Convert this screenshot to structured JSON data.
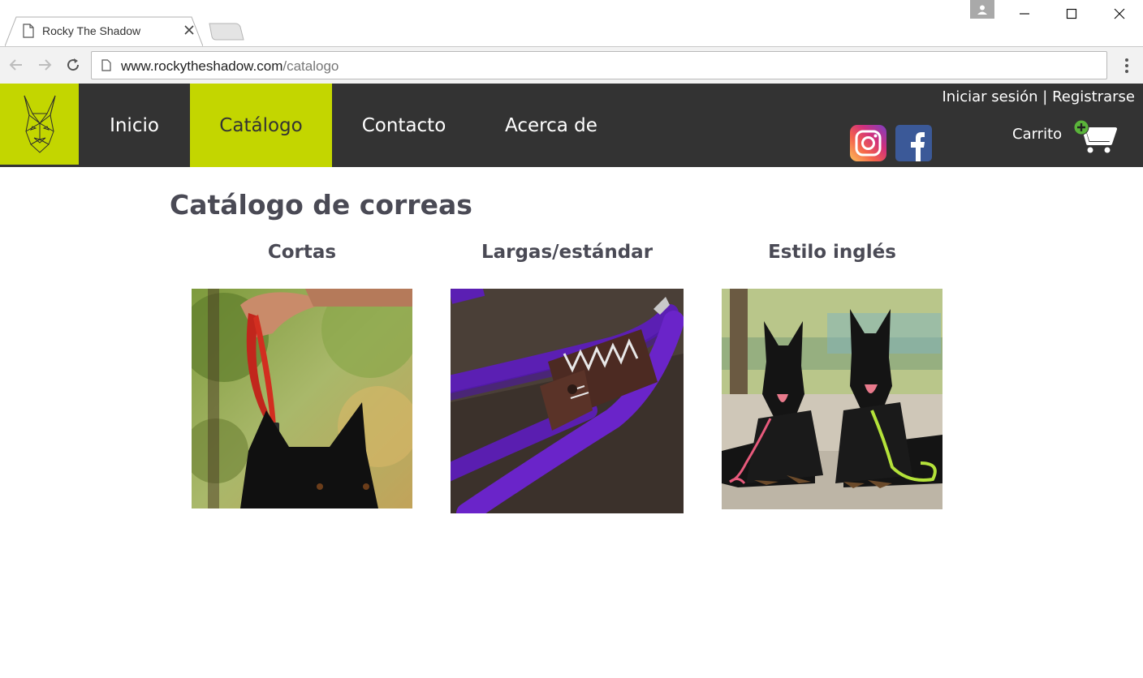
{
  "browser": {
    "tab_title": "Rocky The Shadow",
    "url_host": "www.rockytheshadow.com",
    "url_path": "/catalogo"
  },
  "colors": {
    "accent": "#c3d600",
    "header_bg": "#333333",
    "heading_text": "#4a4a55"
  },
  "header": {
    "logo": "geometric-dog-logo",
    "nav": [
      {
        "label": "Inicio"
      },
      {
        "label": "Catálogo",
        "active": true
      },
      {
        "label": "Contacto"
      },
      {
        "label": "Acerca de"
      }
    ],
    "login_label": "Iniciar sesión",
    "separator": "|",
    "register_label": "Registrarse",
    "social": [
      "instagram-icon",
      "facebook-icon"
    ],
    "cart_label": "Carrito",
    "cart_icon": "cart-add-icon"
  },
  "main": {
    "title": "Catálogo de correas",
    "categories": [
      {
        "title": "Cortas",
        "image": "short-leash-black-dog-photo"
      },
      {
        "title": "Largas/estándar",
        "image": "purple-rope-leash-photo"
      },
      {
        "title": "Estilo inglés",
        "image": "two-shepherds-photo"
      }
    ]
  }
}
